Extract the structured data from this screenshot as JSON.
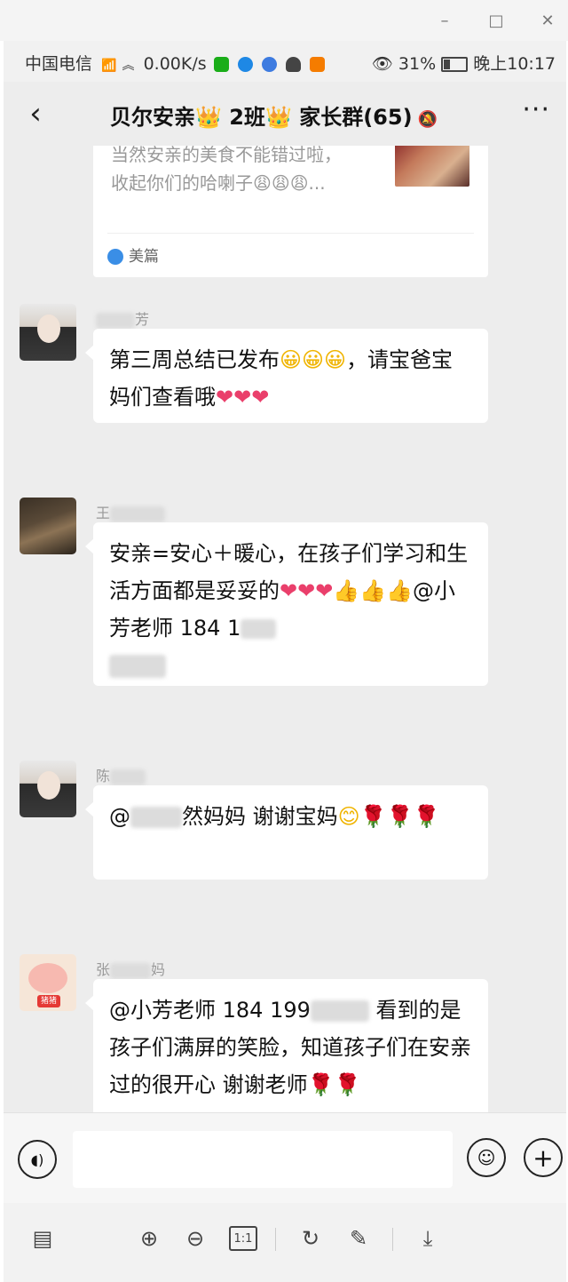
{
  "window": {
    "minimize_glyph": "–",
    "maximize_glyph": "□",
    "close_glyph": "✕"
  },
  "status_bar": {
    "carrier": "中国电信",
    "network_speed": "0.00K/s",
    "battery": "31%",
    "time": "晚上10:17"
  },
  "nav": {
    "back_glyph": "‹",
    "title_part1": "贝尔安亲",
    "title_part2": "2班",
    "title_part3": "家长群(65)",
    "more_glyph": "···"
  },
  "shared_card": {
    "line1": "当然安亲的美食不能错过啦，",
    "line2": "收起你们的哈喇子😩😩😩...",
    "source": "美篇"
  },
  "messages": [
    {
      "sender_visible": "芳",
      "text_a": "第三周总结已发布",
      "text_b": "，请宝爸宝妈们查看哦"
    },
    {
      "sender_visible": "王",
      "text_a": "安亲=安心＋暖心，在孩子们学习和生活方面都是妥妥的",
      "text_b": "@小芳老师   184  1"
    },
    {
      "sender_visible": "陈",
      "text_a": "@",
      "text_b": "然妈妈   谢谢宝妈"
    },
    {
      "sender_visible_a": "张",
      "sender_visible_b": "妈",
      "text_a": "@小芳老师   184  199",
      "text_b": "   看到的是孩子们满屏的笑脸，知道孩子们在安亲过的很开心 谢谢老师"
    }
  ],
  "avatar_labels": {
    "pig_tag": "猪猪"
  },
  "input_bar": {
    "text_value": ""
  },
  "viewer_toolbar": {
    "ratio_label": "1:1"
  },
  "colors": {
    "chat_bg": "#ededed",
    "bubble_bg": "#ffffff",
    "heart": "#ea3f6b",
    "rose": "#d51c2c"
  }
}
